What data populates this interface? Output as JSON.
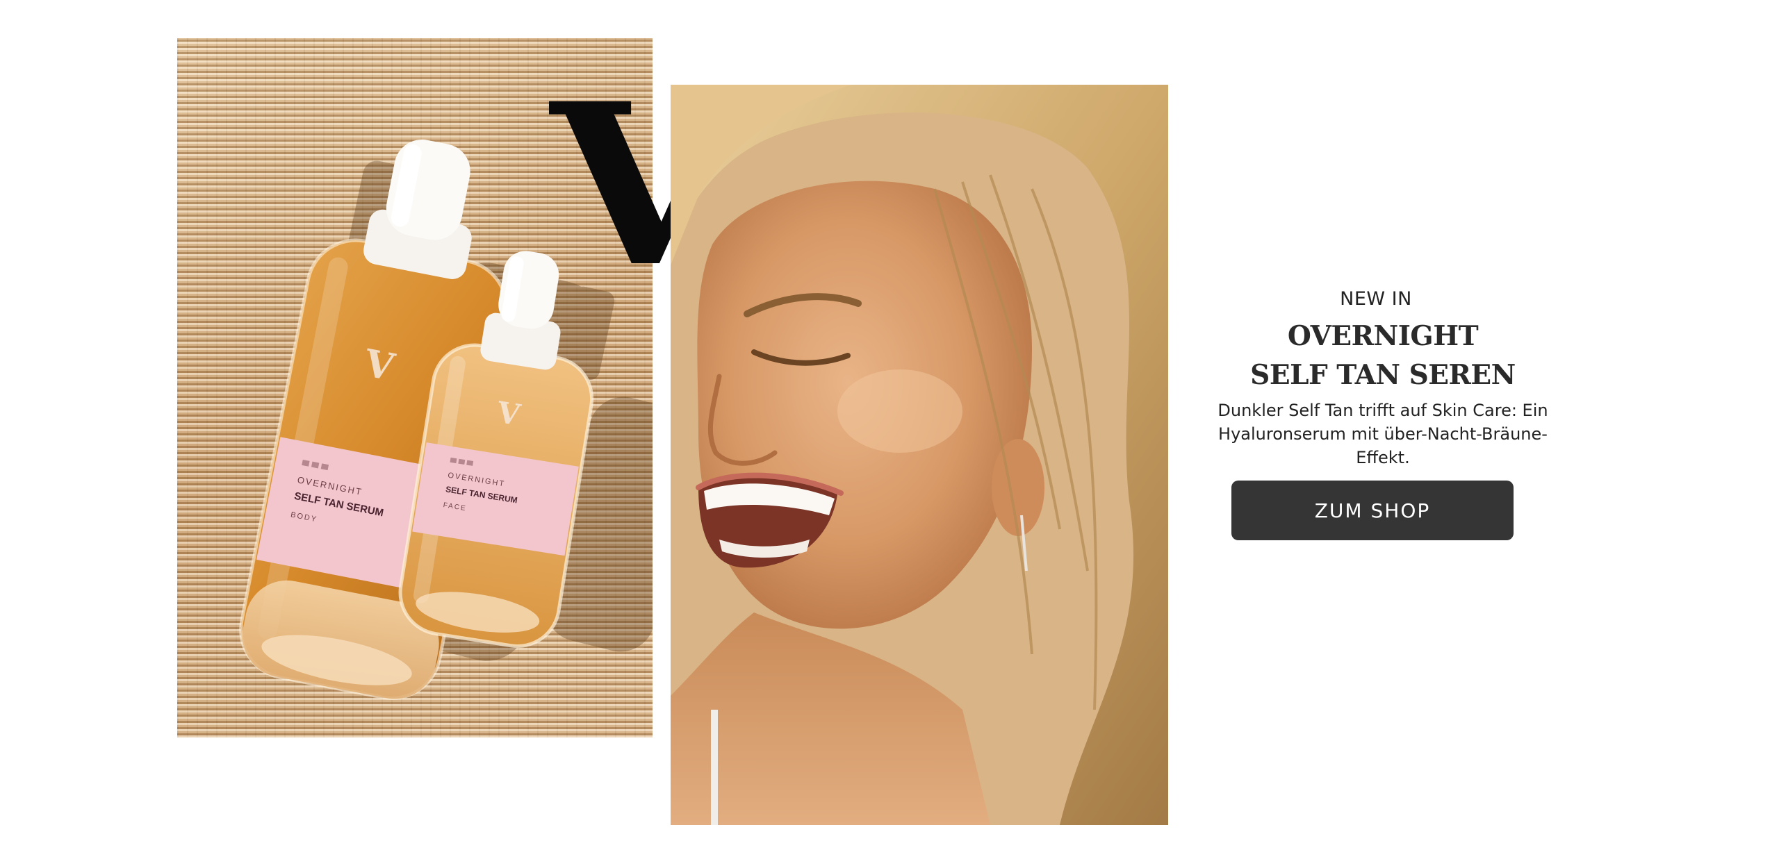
{
  "brand": {
    "logo_letter": "V"
  },
  "product_image": {
    "large_bottle": {
      "logo": "V",
      "line": "OVERNIGHT",
      "name": "SELF TAN SERUM",
      "variant": "BODY"
    },
    "small_bottle": {
      "logo": "V",
      "line": "OVERNIGHT",
      "name": "SELF TAN SERUM",
      "variant": "FACE"
    }
  },
  "promo": {
    "eyebrow": "NEW IN",
    "headline_line1": "OVERNIGHT",
    "headline_line2": "SELF TAN SEREN",
    "description": "Dunkler Self Tan trifft auf Skin Care: Ein Hyaluronserum mit über-Nacht-Bräune-Effekt.",
    "button_label": "ZUM SHOP"
  },
  "colors": {
    "button_bg": "#353535",
    "button_text": "#ffffff",
    "heading_text": "#2a2a2a",
    "label_pink": "#f2c6cc",
    "serum_amber": "#d68a2a"
  }
}
